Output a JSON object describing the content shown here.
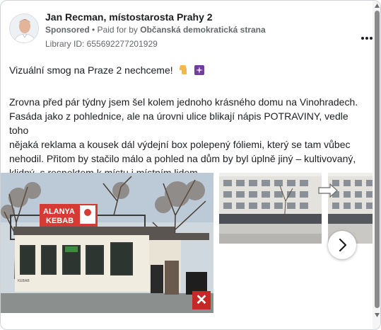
{
  "post": {
    "author": "Jan Recman, místostarosta Prahy 2",
    "sponsored": "Sponsored",
    "separator": " • ",
    "paid_for": "Paid for by ",
    "payer": "Občanská demokratická strana",
    "library_id": "Library ID: 655692277201929",
    "more_icon": "more-horizontal-icon",
    "more_label": "•••",
    "intro": "Vizuální smog na Praze 2 nechceme!",
    "intro_emojis": [
      "thumbs-down-icon",
      "purple-sparkle-icon"
    ],
    "body_lines": [
      "Zrovna před pár týdny jsem šel kolem jednoho krásného domu na Vinohradech.",
      "Fasáda jako z pohlednice, ale na úrovni ulice blikají nápis POTRAVINY, vedle toho",
      "nějaká reklama a kousek dál výdejní box polepený fóliemi, který se tam vůbec",
      "nehodil. Přitom by stačilo málo a pohled na dům by byl úplně jiný – kultivovaný,",
      "klidný, s respektem k místu i místním lidem...."
    ]
  },
  "media": {
    "kiosk_sign_line1": "ALANYA",
    "kiosk_sign_line2": "KEBAB",
    "kiosk_small_label": "KEBAB",
    "close_label": "✕",
    "next_icon": "chevron-right-icon"
  },
  "colors": {
    "text": "#1c1e21",
    "secondary": "#65676b",
    "close_red": "#c62828",
    "sign_red": "#d63a35"
  }
}
